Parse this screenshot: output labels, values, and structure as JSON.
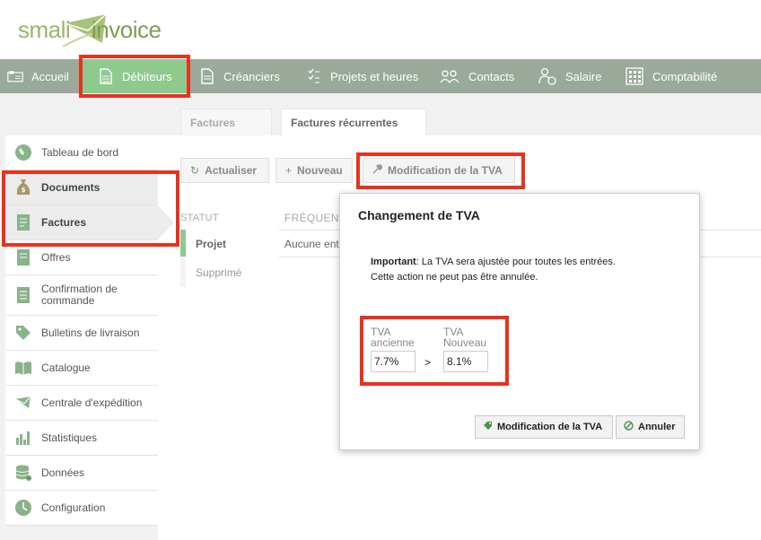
{
  "logo": {
    "small": "small",
    "invoice": "invoice"
  },
  "nav": {
    "items": [
      {
        "label": "Accueil",
        "icon": "home-icon"
      },
      {
        "label": "Débiteurs",
        "icon": "document-icon"
      },
      {
        "label": "Créanciers",
        "icon": "document-icon"
      },
      {
        "label": "Projets et heures",
        "icon": "checklist-icon"
      },
      {
        "label": "Contacts",
        "icon": "people-icon"
      },
      {
        "label": "Salaire",
        "icon": "person-money-icon"
      },
      {
        "label": "Comptabilité",
        "icon": "calculator-icon"
      }
    ],
    "active": "Débiteurs",
    "accent": "#8ec98e"
  },
  "subtabs": [
    {
      "label": "Factures"
    },
    {
      "label": "Factures récurrentes"
    }
  ],
  "sidebar": {
    "items": [
      {
        "label": "Tableau de bord",
        "icon": "globe-icon"
      },
      {
        "label": "Documents",
        "icon": "money-bag-icon"
      },
      {
        "label": "Factures",
        "icon": "invoice-icon"
      },
      {
        "label": "Offres",
        "icon": "offer-icon"
      },
      {
        "label": "Confirmation de commande",
        "icon": "order-icon"
      },
      {
        "label": "Bulletins de livraison",
        "icon": "tag-icon"
      },
      {
        "label": "Catalogue",
        "icon": "book-icon"
      },
      {
        "label": "Centrale d'expédition",
        "icon": "mail-icon"
      },
      {
        "label": "Statistiques",
        "icon": "bar-chart-icon"
      },
      {
        "label": "Données",
        "icon": "database-icon"
      },
      {
        "label": "Configuration",
        "icon": "clock-icon"
      }
    ]
  },
  "toolbar": {
    "refresh": "Actualiser",
    "new": "Nouveau",
    "vat_change": "Modification de la TVA"
  },
  "list": {
    "col_status": "STATUT",
    "col_frequency": "FRÉQUENC",
    "status_items": [
      "Projet",
      "Supprimé"
    ],
    "empty_text": "Aucune ent"
  },
  "dialog": {
    "title": "Changement de TVA",
    "important_label": "Important",
    "line1": ": La TVA sera ajustée pour toutes les entrées.",
    "line2": "Cette action ne peut pas être annulée.",
    "old_label_1": "TVA",
    "old_label_2": "ancienne",
    "new_label_1": "TVA",
    "new_label_2": "Nouveau",
    "arrow": ">",
    "old_value": "7.7%",
    "new_value": "8.1%",
    "confirm": "Modification de la TVA",
    "cancel": "Annuler"
  },
  "colors": {
    "highlight": "#e8321e",
    "nav_bg": "#9aa99a",
    "green": "#6aa86a"
  }
}
